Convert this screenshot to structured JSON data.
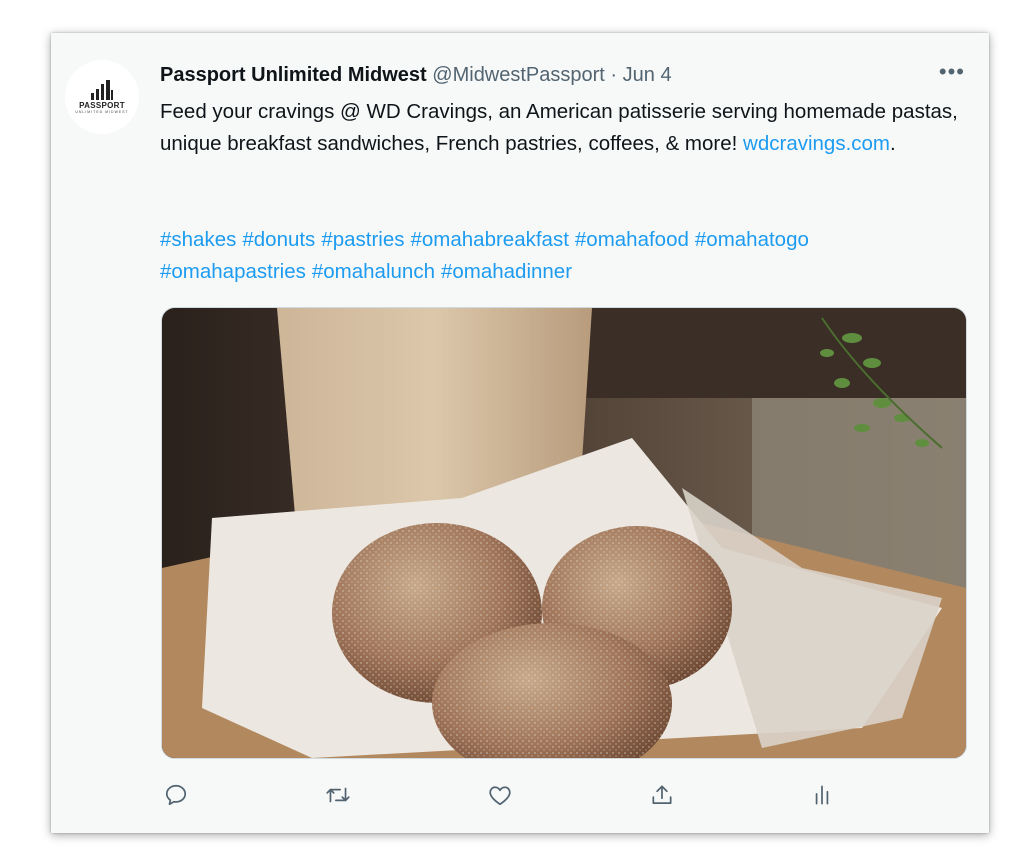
{
  "tweet": {
    "display_name": "Passport Unlimited Midwest",
    "handle": "@MidwestPassport",
    "separator": "·",
    "date": "Jun 4",
    "more_label": "•••",
    "text_before_link": "Feed your cravings @ WD Cravings, an American patisserie serving homemade pastas, unique breakfast sandwiches, French pastries, coffees, & more!  ",
    "link_text": "wdcravings.com",
    "text_after_link": ".",
    "hashtags": [
      "#shakes",
      "#donuts",
      "#pastries",
      "#omahabreakfast",
      "#omahafood",
      "#omahatogo",
      "#omahapastries",
      "#omahalunch",
      "#omahadinner"
    ]
  },
  "avatar": {
    "brand_word": "PASSPORT",
    "brand_sub": "UNLIMITED MIDWEST"
  },
  "media": {
    "icon": "photo-donuts-milkshake"
  },
  "actions": [
    {
      "name": "reply",
      "icon": "speech-bubble-icon"
    },
    {
      "name": "retweet",
      "icon": "retweet-icon"
    },
    {
      "name": "like",
      "icon": "heart-icon"
    },
    {
      "name": "share",
      "icon": "share-icon"
    },
    {
      "name": "analytics",
      "icon": "analytics-icon"
    }
  ],
  "colors": {
    "link": "#1d9bf0",
    "muted": "#536471",
    "card_bg": "#f7f9f9"
  }
}
